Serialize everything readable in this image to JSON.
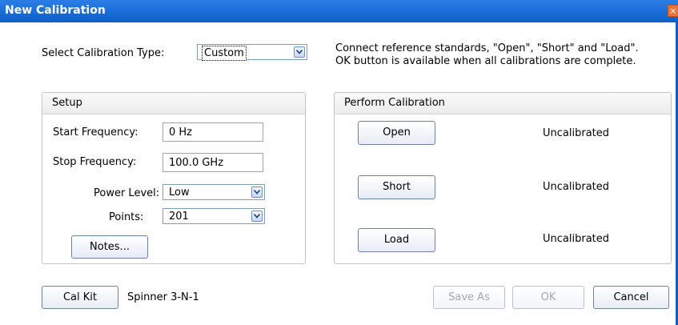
{
  "window": {
    "title": "New Calibration",
    "close_glyph": "×"
  },
  "calibration_type": {
    "label": "Select Calibration Type:",
    "value": "Custom"
  },
  "instructions": {
    "line1": "Connect reference standards, \"Open\", \"Short\" and \"Load\".",
    "line2": "OK button is available when all calibrations are complete."
  },
  "setup": {
    "header": "Setup",
    "start_freq_label": "Start Frequency:",
    "start_freq_value": "0 Hz",
    "stop_freq_label": "Stop Frequency:",
    "stop_freq_value": "100.0 GHz",
    "power_level_label": "Power Level:",
    "power_level_value": "Low",
    "points_label": "Points:",
    "points_value": "201",
    "notes_button": "Notes..."
  },
  "perform": {
    "header": "Perform Calibration",
    "open_button": "Open",
    "open_status": "Uncalibrated",
    "short_button": "Short",
    "short_status": "Uncalibrated",
    "load_button": "Load",
    "load_status": "Uncalibrated"
  },
  "footer": {
    "cal_kit_button": "Cal Kit",
    "cal_kit_value": "Spinner 3-N-1",
    "save_as_button": "Save As",
    "ok_button": "OK",
    "cancel_button": "Cancel"
  },
  "colors": {
    "titlebar": "#0e5fc8",
    "close": "#e8763c",
    "disabled_text": "#a6a6a6"
  },
  "icons": {
    "combo_arrow": "chevron-down-icon",
    "close": "close-icon"
  }
}
